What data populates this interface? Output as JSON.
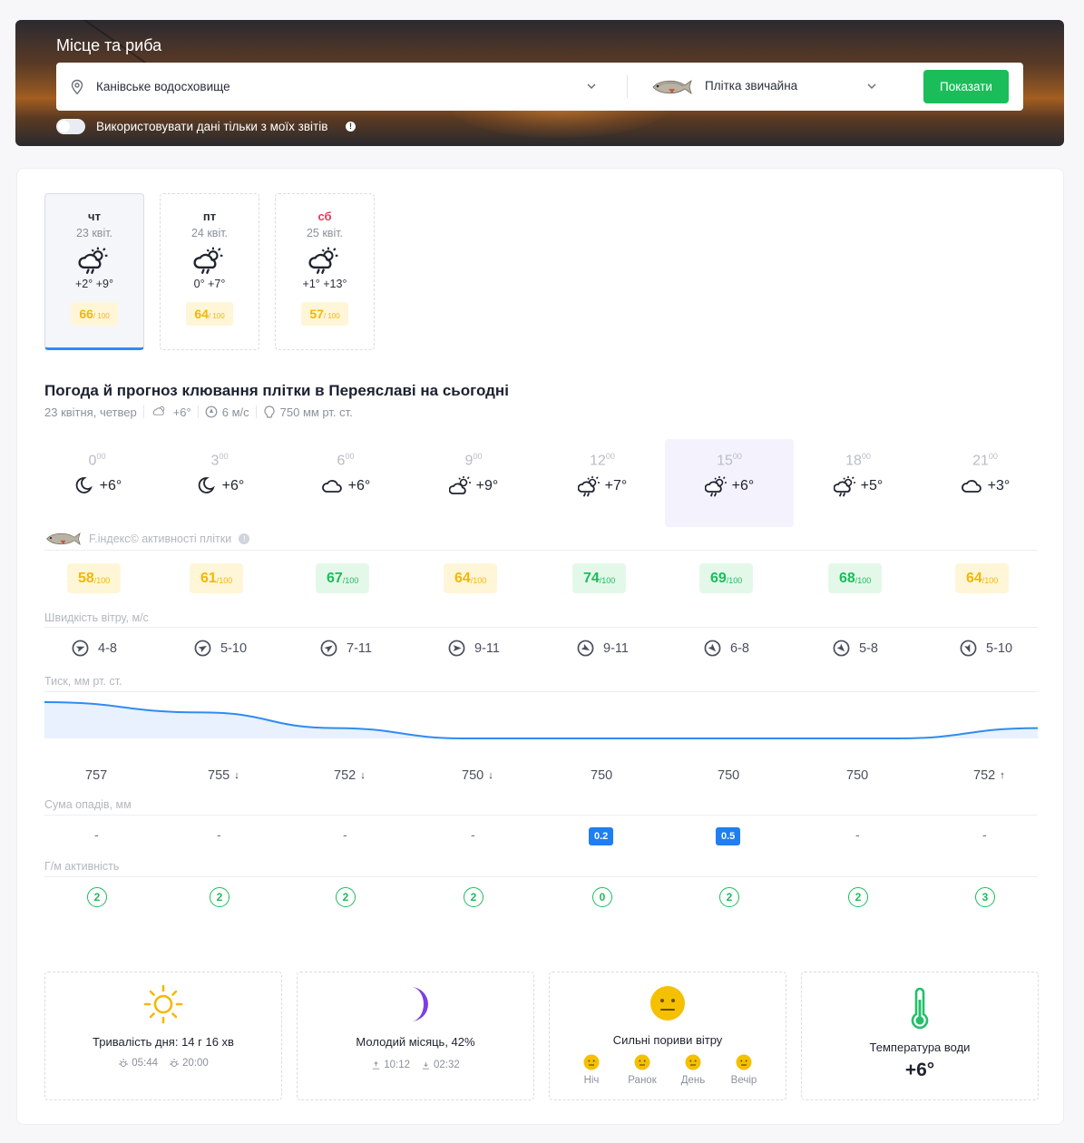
{
  "header": {
    "title": "Місце та риба",
    "location": "Канівське водосховище",
    "fish": "Плітка звичайна",
    "show_button": "Показати",
    "toggle_label": "Використовувати дані тільки з моїх звітів",
    "info_mark": "!"
  },
  "days": [
    {
      "name": "чт",
      "date": "23 квіт.",
      "temp": "+2°  +9°",
      "score": "66",
      "score_max": "/ 100",
      "weekend": false,
      "active": true
    },
    {
      "name": "пт",
      "date": "24 квіт.",
      "temp": "0°  +7°",
      "score": "64",
      "score_max": "/ 100",
      "weekend": false,
      "active": false
    },
    {
      "name": "сб",
      "date": "25 квіт.",
      "temp": "+1°  +13°",
      "score": "57",
      "score_max": "/ 100",
      "weekend": true,
      "active": false
    }
  ],
  "forecast": {
    "title": "Погода й прогноз клювання плітки в Переяславі на сьогодні",
    "date": "23 квітня, четвер",
    "temp": "+6°",
    "wind": "6 м/с",
    "pressure": "750 мм рт. ст."
  },
  "hours": [
    {
      "h": "0",
      "m": "00",
      "icon": "moon-icon",
      "temp": "+6°"
    },
    {
      "h": "3",
      "m": "00",
      "icon": "moon-icon",
      "temp": "+6°"
    },
    {
      "h": "6",
      "m": "00",
      "icon": "cloud-icon",
      "temp": "+6°"
    },
    {
      "h": "9",
      "m": "00",
      "icon": "partly-cloudy-icon",
      "temp": "+9°"
    },
    {
      "h": "12",
      "m": "00",
      "icon": "cloud-rain-sun-icon",
      "temp": "+7°"
    },
    {
      "h": "15",
      "m": "00",
      "icon": "cloud-rain-sun-icon",
      "temp": "+6°"
    },
    {
      "h": "18",
      "m": "00",
      "icon": "cloud-rain-sun-icon",
      "temp": "+5°"
    },
    {
      "h": "21",
      "m": "00",
      "icon": "cloud-icon",
      "temp": "+3°"
    }
  ],
  "activity": {
    "label": "F.індекс© активності плітки",
    "info_mark": "!",
    "scores": [
      {
        "v": "58",
        "max": "/100",
        "level": "y"
      },
      {
        "v": "61",
        "max": "/100",
        "level": "y"
      },
      {
        "v": "67",
        "max": "/100",
        "level": "g"
      },
      {
        "v": "64",
        "max": "/100",
        "level": "y"
      },
      {
        "v": "74",
        "max": "/100",
        "level": "g"
      },
      {
        "v": "69",
        "max": "/100",
        "level": "g"
      },
      {
        "v": "68",
        "max": "/100",
        "level": "g"
      },
      {
        "v": "64",
        "max": "/100",
        "level": "y"
      }
    ]
  },
  "wind": {
    "label": "Швидкість вітру, м/с",
    "values": [
      "4-8",
      "5-10",
      "7-11",
      "9-11",
      "9-11",
      "6-8",
      "5-8",
      "5-10"
    ],
    "direction_deg": [
      70,
      60,
      55,
      90,
      120,
      135,
      135,
      160
    ]
  },
  "pressure": {
    "label": "Тиск, мм рт. ст.",
    "values": [
      {
        "v": "757",
        "arrow": ""
      },
      {
        "v": "755",
        "arrow": "↓"
      },
      {
        "v": "752",
        "arrow": "↓"
      },
      {
        "v": "750",
        "arrow": "↓"
      },
      {
        "v": "750",
        "arrow": ""
      },
      {
        "v": "750",
        "arrow": ""
      },
      {
        "v": "750",
        "arrow": ""
      },
      {
        "v": "752",
        "arrow": "↑"
      }
    ],
    "series": [
      757,
      755,
      752,
      750,
      750,
      750,
      750,
      752
    ],
    "line_color": "#2f8cf0",
    "fill_color": "#e8f1fd"
  },
  "precip": {
    "label": "Сума опадів, мм",
    "values": [
      "-",
      "-",
      "-",
      "-",
      "0.2",
      "0.5",
      "-",
      "-"
    ]
  },
  "geomag": {
    "label": "Г/м активність",
    "values": [
      "2",
      "2",
      "2",
      "2",
      "0",
      "2",
      "2",
      "3"
    ]
  },
  "cards": {
    "day": {
      "title": "Тривалість дня: 14 г 16 хв",
      "sunrise": "05:44",
      "sunset": "20:00"
    },
    "moon": {
      "title": "Молодий місяць, 42%",
      "rise": "10:12",
      "set": "02:32"
    },
    "gusts": {
      "title": "Сильні пориви вітру",
      "periods": [
        "Ніч",
        "Ранок",
        "День",
        "Вечір"
      ]
    },
    "water": {
      "title": "Температура води",
      "temp": "+6°"
    }
  },
  "colors": {
    "accent": "#2f8cf0",
    "green": "#1bbd5a",
    "yellow": "#f2b705",
    "weekend": "#e63955"
  }
}
